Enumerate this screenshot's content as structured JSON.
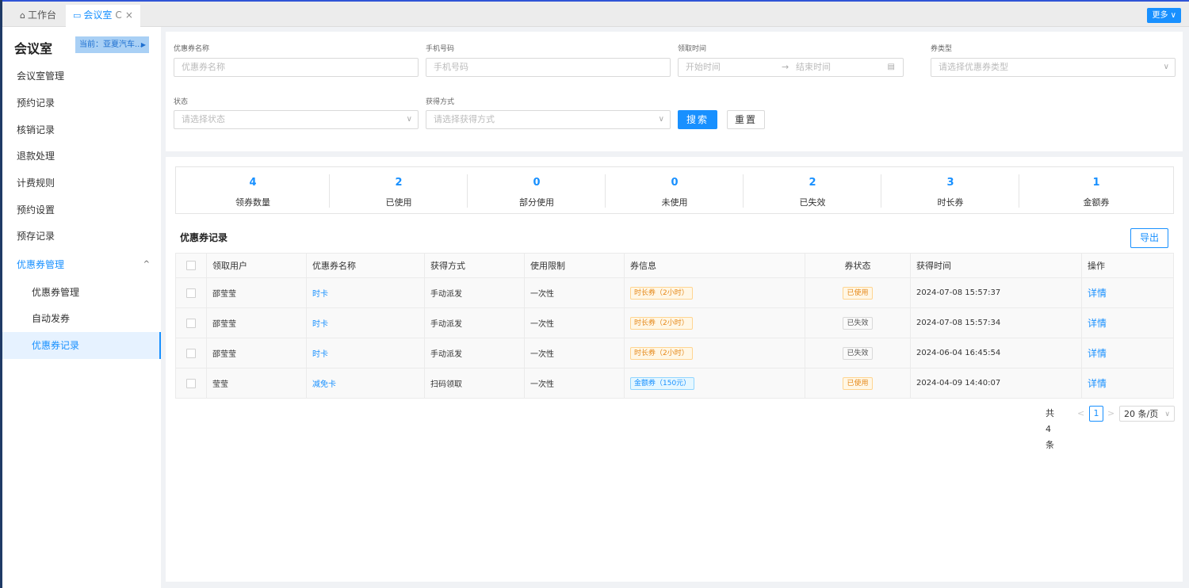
{
  "tabs": [
    {
      "icon": "home-icon",
      "label": "工作台"
    },
    {
      "icon": "monitor-icon",
      "label": "会议室",
      "refresh_glyph": "C",
      "close_glyph": "×"
    }
  ],
  "more_label": "更多",
  "sidebar": {
    "title": "会议室",
    "current": "当前：亚夏汽车...",
    "items": [
      {
        "label": "会议室管理"
      },
      {
        "label": "预约记录"
      },
      {
        "label": "核销记录"
      },
      {
        "label": "退款处理"
      },
      {
        "label": "计费规则"
      },
      {
        "label": "预约设置"
      },
      {
        "label": "预存记录"
      },
      {
        "label": "优惠券管理",
        "expanded": true
      },
      {
        "label": "优惠券管理"
      },
      {
        "label": "自动发券"
      },
      {
        "label": "优惠券记录",
        "active": true
      }
    ]
  },
  "filters": {
    "coupon_name": {
      "label": "优惠券名称",
      "placeholder": "优惠券名称"
    },
    "phone": {
      "label": "手机号码",
      "placeholder": "手机号码"
    },
    "claim_time": {
      "label": "领取时间",
      "start_placeholder": "开始时间",
      "end_placeholder": "结束时间",
      "separator": "→"
    },
    "coupon_type": {
      "label": "券类型",
      "placeholder": "请选择优惠券类型"
    },
    "status": {
      "label": "状态",
      "placeholder": "请选择状态"
    },
    "obtain_method": {
      "label": "获得方式",
      "placeholder": "请选择获得方式"
    },
    "search_label": "搜索",
    "reset_label": "重置"
  },
  "stats": [
    {
      "value": "4",
      "label": "领券数量"
    },
    {
      "value": "2",
      "label": "已使用"
    },
    {
      "value": "0",
      "label": "部分使用"
    },
    {
      "value": "0",
      "label": "未使用"
    },
    {
      "value": "2",
      "label": "已失效"
    },
    {
      "value": "3",
      "label": "时长券"
    },
    {
      "value": "1",
      "label": "金额券"
    }
  ],
  "section_title": "优惠券记录",
  "export_label": "导出",
  "table": {
    "columns": [
      "领取用户",
      "优惠券名称",
      "获得方式",
      "使用限制",
      "券信息",
      "券状态",
      "获得时间",
      "操作"
    ],
    "rows": [
      {
        "user": "邵莹莹",
        "coupon": "时卡",
        "method": "手动派发",
        "limit": "一次性",
        "info": "时长券（2小时）",
        "info_color": "#e6891a",
        "status": "已使用",
        "status_color": "#e6891a",
        "time": "2024-07-08 15:57:37",
        "action": "详情"
      },
      {
        "user": "邵莹莹",
        "coupon": "时卡",
        "method": "手动派发",
        "limit": "一次性",
        "info": "时长券（2小时）",
        "info_color": "#e6891a",
        "status": "已失效",
        "status_color": "#555555",
        "time": "2024-07-08 15:57:34",
        "action": "详情"
      },
      {
        "user": "邵莹莹",
        "coupon": "时卡",
        "method": "手动派发",
        "limit": "一次性",
        "info": "时长券（2小时）",
        "info_color": "#e6891a",
        "status": "已失效",
        "status_color": "#555555",
        "time": "2024-06-04 16:45:54",
        "action": "详情"
      },
      {
        "user": "莹莹",
        "coupon": "减免卡",
        "method": "扫码领取",
        "limit": "一次性",
        "info": "金额券（150元）",
        "info_color": "#1890ff",
        "status": "已使用",
        "status_color": "#e6891a",
        "time": "2024-04-09 14:40:07",
        "action": "详情"
      }
    ]
  },
  "pagination": {
    "total": "共4条",
    "prev_glyph": "<",
    "current_page": "1",
    "next_glyph": ">",
    "page_size": "20 条/页"
  }
}
